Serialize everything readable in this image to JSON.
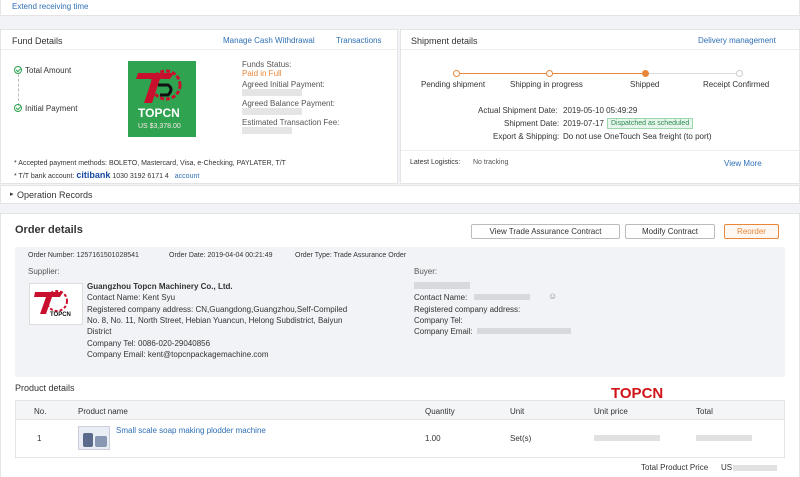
{
  "top": {
    "extend_link": "Extend receiving time"
  },
  "fund": {
    "title": "Fund Details",
    "manage_link": "Manage Cash Withdrawal",
    "transactions_link": "Transactions",
    "total_amount_label": "Total Amount",
    "initial_payment_label": "Initial Payment",
    "logo_text": "TOPCN",
    "logo_amount": "US $3,378.00",
    "funds_status_label": "Funds Status:",
    "funds_status_value": "Paid in Full",
    "agreed_initial_label": "Agreed Initial Payment:",
    "agreed_balance_label": "Agreed Balance Payment:",
    "estimated_fee_label": "Estimated Transaction Fee:",
    "accepted_methods": "* Accepted payment methods: BOLETO, Mastercard, Visa, e-Checking, PAYLATER, T/T",
    "tt_label": "* T/T bank account:",
    "bank_name": "citibank",
    "bank_number": "1030 3192 6171 4",
    "account_link": "account"
  },
  "shipment": {
    "title": "Shipment details",
    "delivery_link": "Delivery management",
    "steps": [
      "Pending shipment",
      "Shipping in progress",
      "Shipped",
      "Receipt Confirmed"
    ],
    "actual_date_label": "Actual Shipment Date:",
    "actual_date_value": "2019-05-10 05:49:29",
    "shipment_date_label": "Shipment Date:",
    "shipment_date_value": "2019-07-17",
    "dispatched_badge": "Dispatched as scheduled",
    "export_label": "Export & Shipping:",
    "export_value": "Do not use OneTouch Sea freight (to port)",
    "latest_logistics_label": "Latest Logistics:",
    "latest_logistics_value": "No tracking",
    "view_more": "View More"
  },
  "operation_records": "Operation Records",
  "order": {
    "title": "Order details",
    "btn_trade_contract": "View Trade Assurance Contract",
    "btn_modify": "Modify Contract",
    "btn_reorder": "Reorder",
    "order_number": "Order Number: 1257161501028541",
    "order_date": "Order Date: 2019-04-04 00:21:49",
    "order_type": "Order Type: Trade Assurance Order",
    "supplier_label": "Supplier:",
    "supplier_company": "Guangzhou Topcn Machinery Co., Ltd.",
    "supplier_contact": "Contact Name: Kent Syu",
    "supplier_address_1": "Registered company address: CN,Guangdong,Guangzhou,Self-Compiled",
    "supplier_address_2": "No. 8, No. 11, North Street, Hebian Yuancun, Helong Subdistrict, Baiyun",
    "supplier_address_3": "District",
    "supplier_tel": "Company Tel: 0086-020-29040856",
    "supplier_email": "Company Email: kent@topcnpackagemachine.com",
    "supplier_logo_text": "TOPCN",
    "buyer_label": "Buyer:",
    "buyer_contact_label": "Contact Name:",
    "buyer_address_label": "Registered company address:",
    "buyer_tel_label": "Company Tel:",
    "buyer_email_label": "Company Email:"
  },
  "products": {
    "title": "Product details",
    "watermark": "TOPCN",
    "columns": [
      "No.",
      "Product name",
      "Quantity",
      "Unit",
      "Unit price",
      "Total"
    ],
    "rows": [
      {
        "no": "1",
        "name": "Small scale soap making plodder machine",
        "quantity": "1.00",
        "unit": "Set(s)"
      }
    ],
    "total_label": "Total Product Price",
    "total_prefix": "US"
  }
}
